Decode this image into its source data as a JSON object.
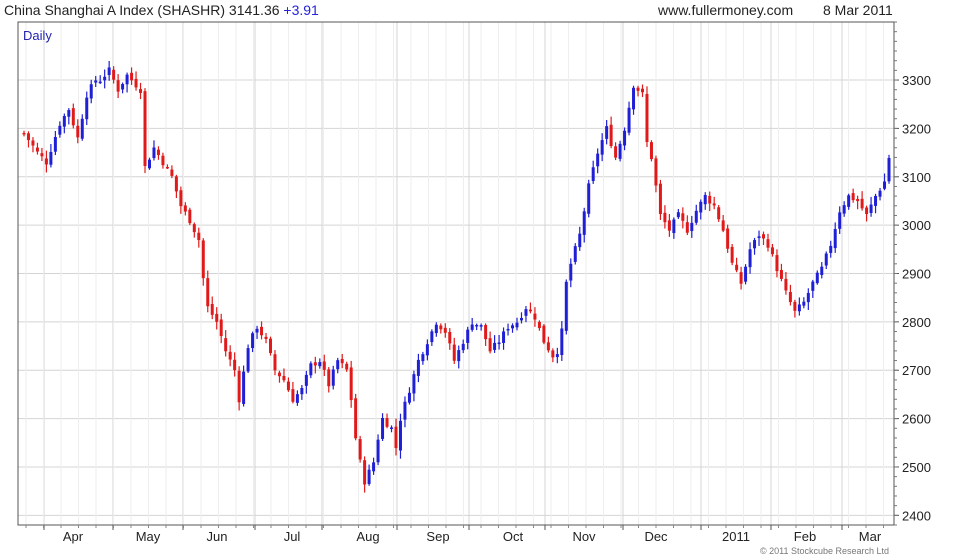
{
  "header": {
    "index_name": "China Shanghai A Index (SHASHR)",
    "last_price": "3141.36",
    "change": "+3.91",
    "website": "www.fullermoney.com",
    "date": "8 Mar 2011"
  },
  "copyright": "© 2011 Stockcube Research Ltd",
  "colors": {
    "up": "#1f1fd6",
    "down": "#e01a1a",
    "grid": "#d4d4d4",
    "frame": "#555555"
  },
  "chart_data": {
    "type": "candlestick",
    "interval_label": "Daily",
    "ylim": [
      2380,
      3420
    ],
    "y_ticks": [
      2400,
      2500,
      2600,
      2700,
      2800,
      2900,
      3000,
      3100,
      3200,
      3300
    ],
    "x_ticks": [
      "Apr",
      "May",
      "Jun",
      "Jul",
      "Aug",
      "Sep",
      "Oct",
      "Nov",
      "Dec",
      "2011",
      "Feb",
      "Mar"
    ],
    "grid": true,
    "close_path": [
      [
        0,
        3190
      ],
      [
        3,
        3150
      ],
      [
        5,
        3130
      ],
      [
        8,
        3210
      ],
      [
        10,
        3240
      ],
      [
        12,
        3180
      ],
      [
        14,
        3270
      ],
      [
        16,
        3300
      ],
      [
        17,
        3300
      ],
      [
        19,
        3320
      ],
      [
        21,
        3280
      ],
      [
        23,
        3310
      ],
      [
        24,
        3300
      ],
      [
        26,
        3280
      ],
      [
        27,
        3120
      ],
      [
        29,
        3160
      ],
      [
        31,
        3130
      ],
      [
        33,
        3100
      ],
      [
        35,
        3040
      ],
      [
        37,
        3010
      ],
      [
        39,
        2970
      ],
      [
        40,
        2890
      ],
      [
        41,
        2830
      ],
      [
        43,
        2800
      ],
      [
        45,
        2740
      ],
      [
        47,
        2700
      ],
      [
        48,
        2640
      ],
      [
        50,
        2750
      ],
      [
        52,
        2790
      ],
      [
        54,
        2760
      ],
      [
        56,
        2700
      ],
      [
        58,
        2680
      ],
      [
        60,
        2640
      ],
      [
        62,
        2660
      ],
      [
        64,
        2710
      ],
      [
        66,
        2720
      ],
      [
        68,
        2670
      ],
      [
        70,
        2720
      ],
      [
        72,
        2700
      ],
      [
        73,
        2640
      ],
      [
        74,
        2560
      ],
      [
        75,
        2510
      ],
      [
        76,
        2470
      ],
      [
        78,
        2510
      ],
      [
        79,
        2560
      ],
      [
        80,
        2600
      ],
      [
        82,
        2580
      ],
      [
        83,
        2540
      ],
      [
        84,
        2600
      ],
      [
        86,
        2660
      ],
      [
        88,
        2720
      ],
      [
        90,
        2760
      ],
      [
        92,
        2800
      ],
      [
        94,
        2780
      ],
      [
        96,
        2720
      ],
      [
        98,
        2760
      ],
      [
        100,
        2800
      ],
      [
        102,
        2790
      ],
      [
        104,
        2740
      ],
      [
        106,
        2760
      ],
      [
        108,
        2790
      ],
      [
        110,
        2800
      ],
      [
        112,
        2830
      ],
      [
        114,
        2810
      ],
      [
        116,
        2760
      ],
      [
        118,
        2730
      ],
      [
        119,
        2740
      ],
      [
        120,
        2780
      ],
      [
        121,
        2880
      ],
      [
        122,
        2920
      ],
      [
        124,
        2980
      ],
      [
        126,
        3080
      ],
      [
        128,
        3150
      ],
      [
        130,
        3200
      ],
      [
        132,
        3140
      ],
      [
        134,
        3200
      ],
      [
        136,
        3290
      ],
      [
        138,
        3270
      ],
      [
        139,
        3170
      ],
      [
        140,
        3140
      ],
      [
        142,
        3020
      ],
      [
        144,
        2990
      ],
      [
        146,
        3020
      ],
      [
        148,
        2990
      ],
      [
        150,
        3030
      ],
      [
        152,
        3060
      ],
      [
        154,
        3040
      ],
      [
        156,
        2990
      ],
      [
        158,
        2920
      ],
      [
        160,
        2880
      ],
      [
        162,
        2950
      ],
      [
        164,
        2980
      ],
      [
        166,
        2960
      ],
      [
        168,
        2910
      ],
      [
        170,
        2860
      ],
      [
        172,
        2820
      ],
      [
        174,
        2840
      ],
      [
        176,
        2880
      ],
      [
        178,
        2910
      ],
      [
        180,
        2960
      ],
      [
        182,
        3030
      ],
      [
        184,
        3060
      ],
      [
        186,
        3050
      ],
      [
        188,
        3020
      ],
      [
        190,
        3060
      ],
      [
        192,
        3090
      ],
      [
        193,
        3140
      ]
    ]
  }
}
